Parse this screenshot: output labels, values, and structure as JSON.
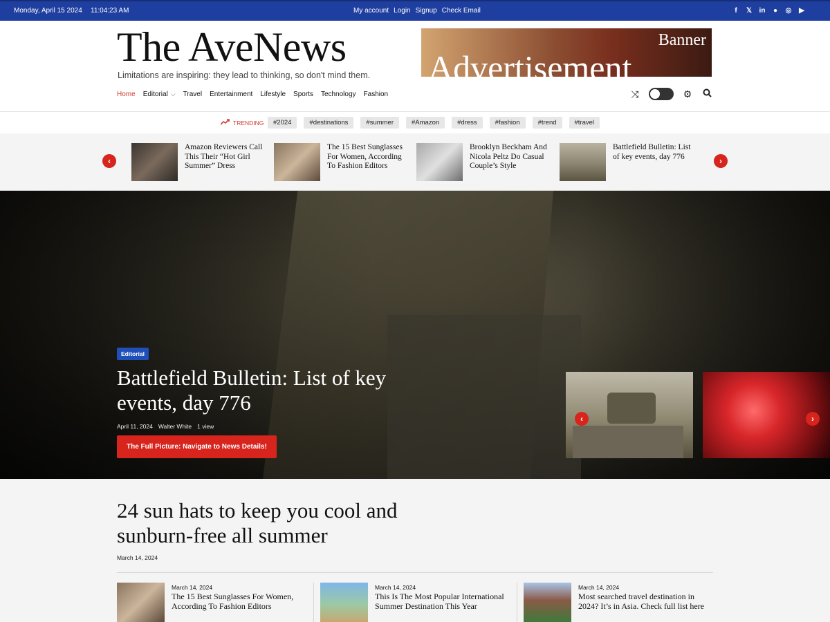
{
  "topbar": {
    "date": "Monday, April 15 2024",
    "time": "11:04:23 AM",
    "links": [
      "My account",
      "Login",
      "Signup",
      "Check Email"
    ],
    "social_icons": [
      "facebook-icon",
      "x-icon",
      "linkedin-icon",
      "spotify-icon",
      "instagram-icon",
      "youtube-icon"
    ]
  },
  "header": {
    "logo": "The AveNews",
    "tagline": "Limitations are inspiring: they lead to thinking, so don't mind them.",
    "banner": {
      "line1": "Banner",
      "line2": "Advertisement"
    }
  },
  "nav": {
    "items": [
      "Home",
      "Editorial",
      "Travel",
      "Entertainment",
      "Lifestyle",
      "Sports",
      "Technology",
      "Fashion"
    ],
    "active_index": 0
  },
  "tools": [
    "shuffle-icon",
    "dark-mode-toggle",
    "gear-icon",
    "search-icon"
  ],
  "trending": {
    "label": "TRENDING",
    "tags": [
      "#2024",
      "#destinations",
      "#summer",
      "#Amazon",
      "#dress",
      "#fashion",
      "#trend",
      "#travel"
    ]
  },
  "mini_carousel": {
    "items": [
      {
        "title": "Amazon Reviewers Call This Their “Hot Girl Summer” Dress"
      },
      {
        "title": "The 15 Best Sunglasses For Women, According To Fashion Editors"
      },
      {
        "title": "Brooklyn Beckham And Nicola Peltz Do Casual Couple’s Style"
      },
      {
        "title": "Battlefield Bulletin: List of key events, day 776"
      }
    ]
  },
  "hero": {
    "category": "Editorial",
    "title": "Battlefield Bulletin: List of key events, day 776",
    "date": "April 11, 2024",
    "author": "Walter White",
    "views": "1 view",
    "cta": "The Full Picture: Navigate to News Details!"
  },
  "featured": {
    "title": "24 sun hats to keep you cool and sunburn-free all summer",
    "date": "March 14, 2024"
  },
  "cards": [
    {
      "date": "March 14, 2024",
      "title": "The 15 Best Sunglasses For Women, According To Fashion Editors"
    },
    {
      "date": "March 14, 2024",
      "title": "This Is The Most Popular International Summer Destination This Year"
    },
    {
      "date": "March 14, 2024",
      "title": "Most searched travel destination in 2024? It’s in Asia. Check full list here"
    }
  ],
  "colors": {
    "topbar": "#1f3fa0",
    "accent": "#d7241c",
    "badge": "#1f4fb8"
  }
}
